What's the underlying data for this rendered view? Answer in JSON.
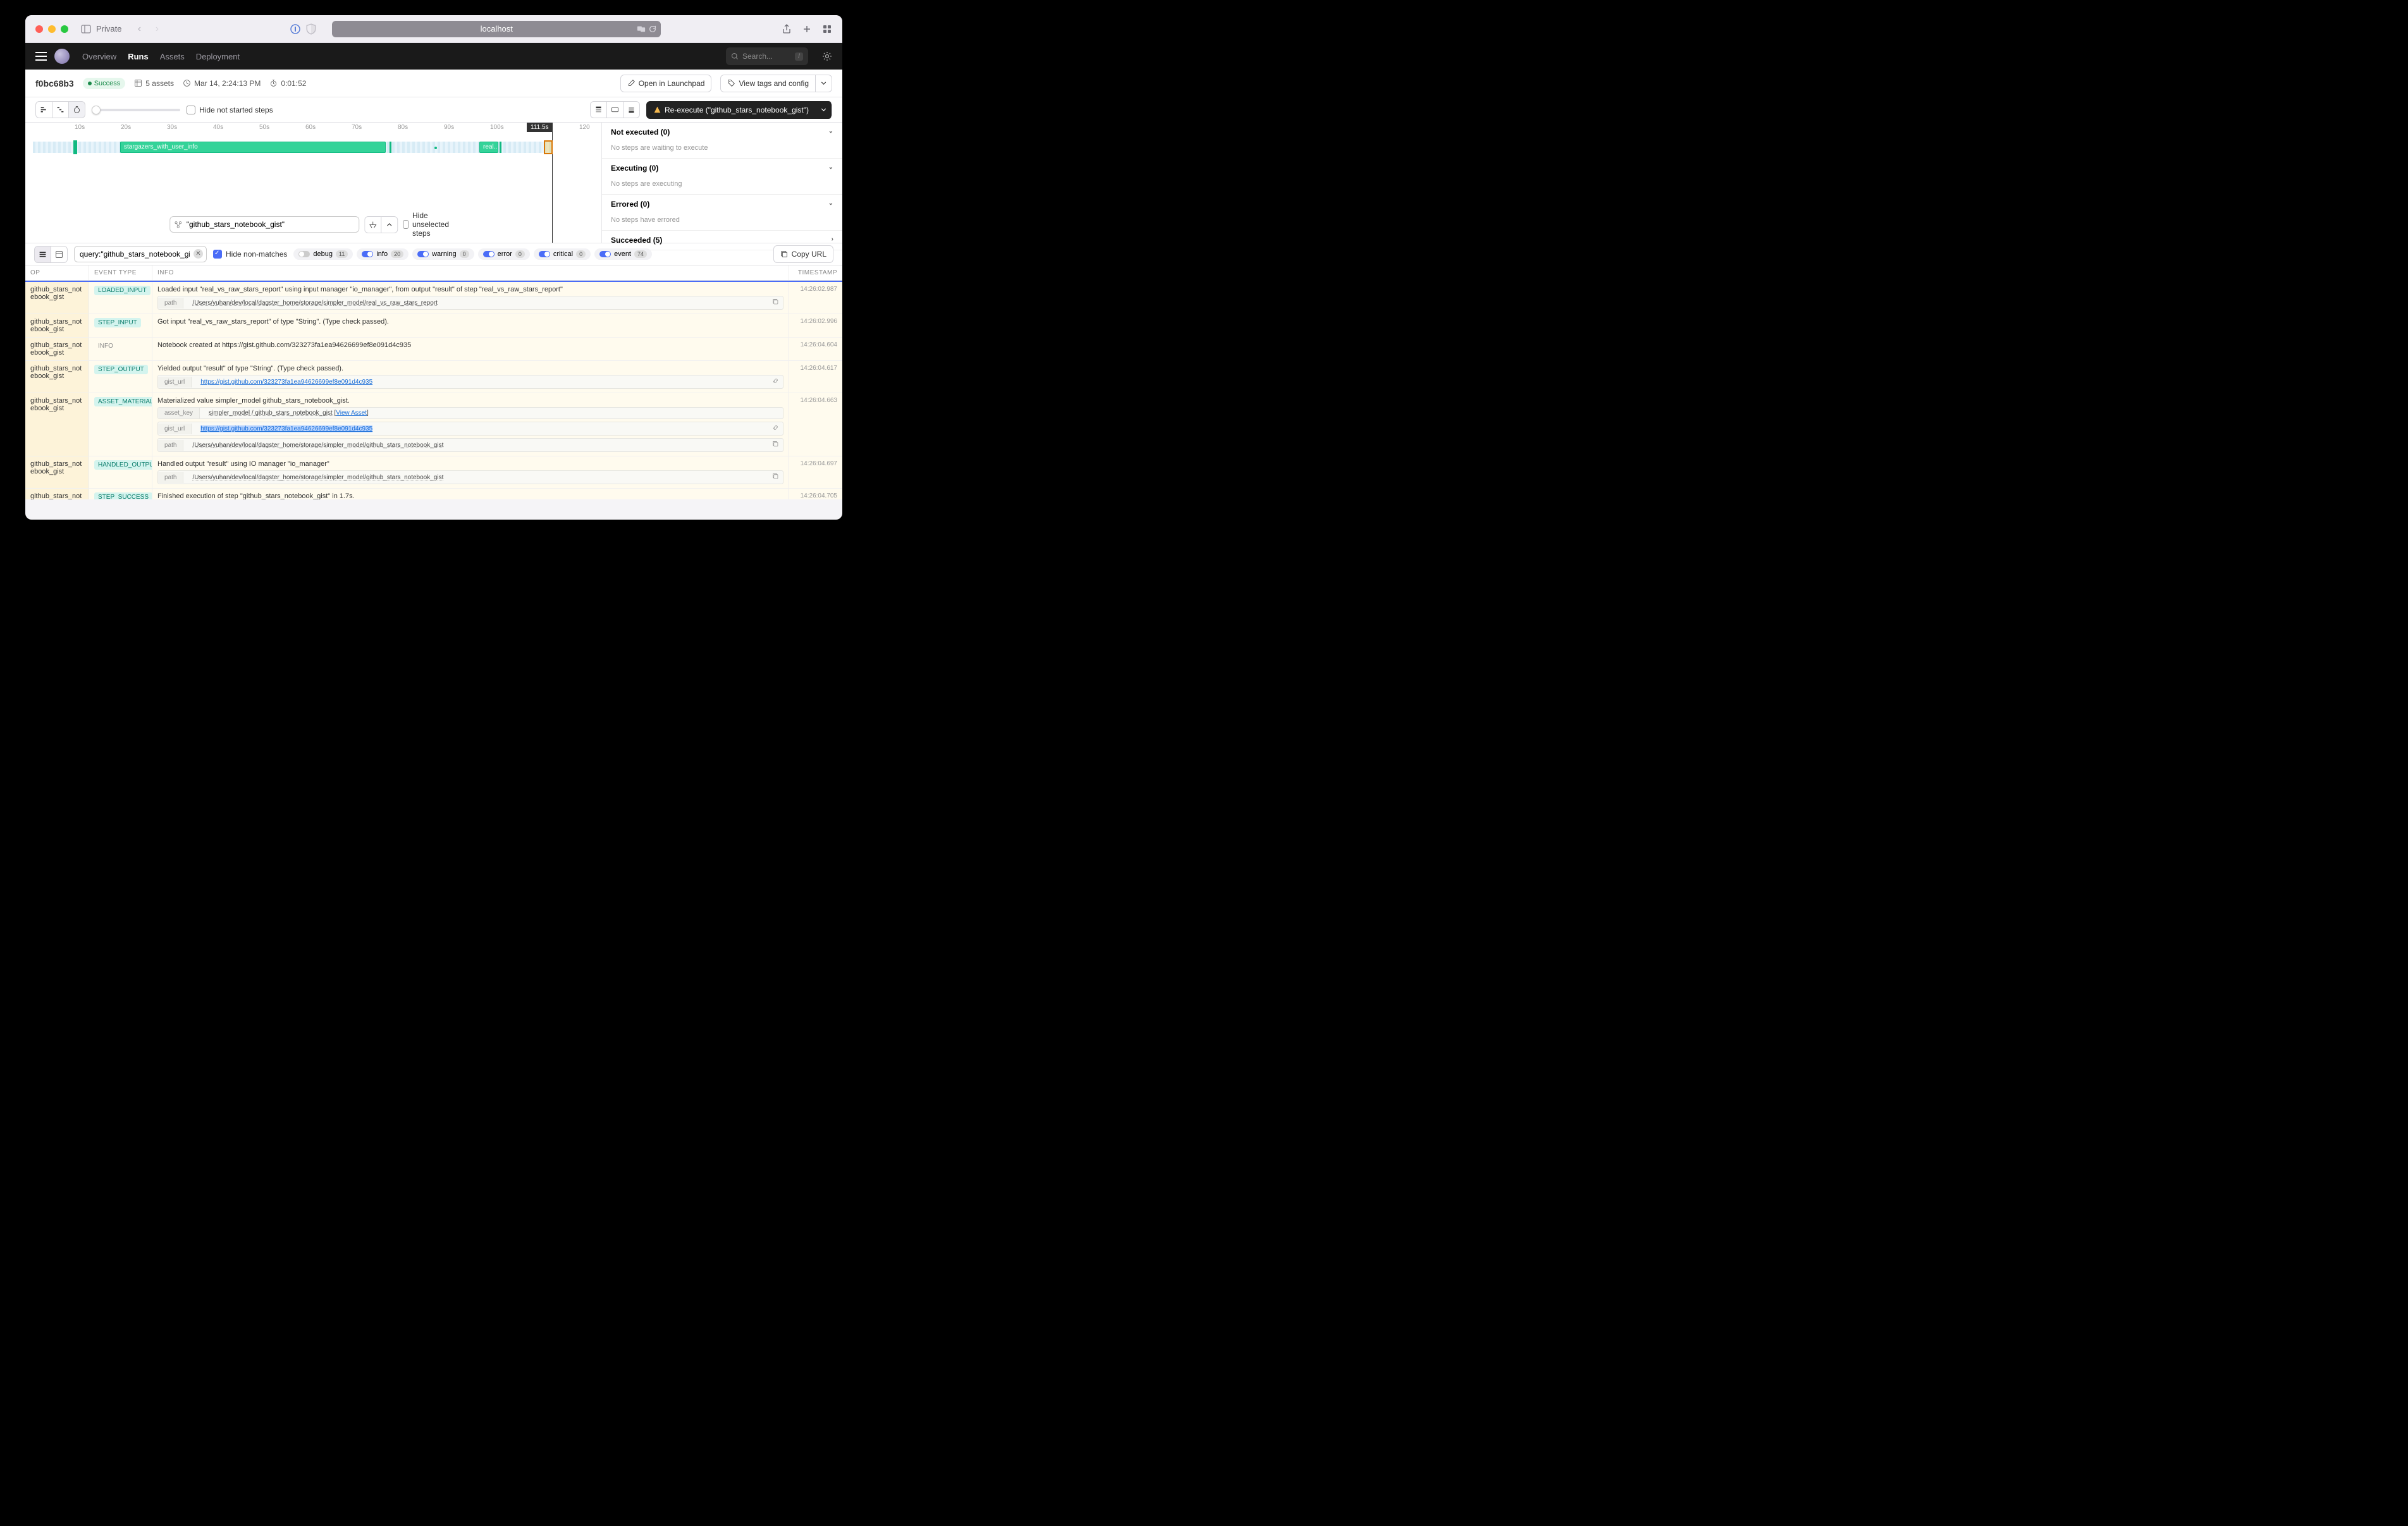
{
  "browser": {
    "private_label": "Private",
    "url": "localhost"
  },
  "nav": {
    "overview": "Overview",
    "runs": "Runs",
    "assets": "Assets",
    "deployment": "Deployment",
    "search_placeholder": "Search...",
    "search_key": "/"
  },
  "run": {
    "id": "f0bc68b3",
    "status": "Success",
    "assets": "5 assets",
    "started": "Mar 14, 2:24:13 PM",
    "duration": "0:01:52",
    "open_launchpad": "Open in Launchpad",
    "view_tags": "View tags and config"
  },
  "toolbar": {
    "hide_not_started": "Hide not started steps",
    "reexecute": "Re-execute (\"github_stars_notebook_gist\")"
  },
  "timeline": {
    "ticks": [
      "10s",
      "20s",
      "30s",
      "40s",
      "50s",
      "60s",
      "70s",
      "80s",
      "90s",
      "100s"
    ],
    "tick_end": "120",
    "current": "111.5s",
    "bar1": "stargazers_with_user_info",
    "bar2": "real..."
  },
  "gantt_filter": {
    "value": "\"github_stars_notebook_gist\"",
    "hide_unselected": "Hide unselected steps"
  },
  "side": {
    "not_executed": {
      "title": "Not executed (0)",
      "body": "No steps are waiting to execute"
    },
    "executing": {
      "title": "Executing (0)",
      "body": "No steps are executing"
    },
    "errored": {
      "title": "Errored (0)",
      "body": "No steps have errored"
    },
    "succeeded": {
      "title": "Succeeded (5)"
    }
  },
  "logs_toolbar": {
    "query": "query:\"github_stars_notebook_gist\"",
    "hide_non_matches": "Hide non-matches",
    "levels": [
      {
        "name": "debug",
        "count": "11",
        "on": false
      },
      {
        "name": "info",
        "count": "20",
        "on": true
      },
      {
        "name": "warning",
        "count": "0",
        "on": true
      },
      {
        "name": "error",
        "count": "0",
        "on": true
      },
      {
        "name": "critical",
        "count": "0",
        "on": true
      },
      {
        "name": "event",
        "count": "74",
        "on": true
      }
    ],
    "copy_url": "Copy URL"
  },
  "log_headers": {
    "op": "OP",
    "type": "EVENT TYPE",
    "info": "INFO",
    "ts": "TIMESTAMP"
  },
  "logs": [
    {
      "op": "github_stars_notebook_gist",
      "type": "LOADED_INPUT",
      "type_class": "evt",
      "info": "Loaded input \"real_vs_raw_stars_report\" using input manager \"io_manager\", from output \"result\" of step \"real_vs_raw_stars_report\"",
      "paths": [
        {
          "key": "path",
          "val": "/Users/yuhan/dev/local/dagster_home/storage/simpler_model/real_vs_raw_stars_report",
          "copy": true
        }
      ],
      "ts": "14:26:02.987"
    },
    {
      "op": "github_stars_notebook_gist",
      "type": "STEP_INPUT",
      "type_class": "evt",
      "info": "Got input \"real_vs_raw_stars_report\" of type \"String\". (Type check passed).",
      "ts": "14:26:02.996"
    },
    {
      "op": "github_stars_notebook_gist",
      "type": "INFO",
      "type_class": "info",
      "info": "Notebook created at https://gist.github.com/323273fa1ea94626699ef8e091d4c935",
      "ts": "14:26:04.604"
    },
    {
      "op": "github_stars_notebook_gist",
      "type": "STEP_OUTPUT",
      "type_class": "evt",
      "info": "Yielded output \"result\" of type \"String\". (Type check passed).",
      "paths": [
        {
          "key": "gist_url",
          "val": "https://gist.github.com/323273fa1ea94626699ef8e091d4c935",
          "link": true
        }
      ],
      "ts": "14:26:04.617"
    },
    {
      "op": "github_stars_notebook_gist",
      "type": "ASSET_MATERIALIZAT...",
      "type_class": "evt",
      "info": "Materialized value simpler_model github_stars_notebook_gist.",
      "paths": [
        {
          "key": "asset_key",
          "val": "simpler_model / github_stars_notebook_gist",
          "view_asset": true
        },
        {
          "key": "gist_url",
          "val": "https://gist.github.com/323273fa1ea94626699ef8e091d4c935",
          "link": true,
          "hl": true
        },
        {
          "key": "path",
          "val": "/Users/yuhan/dev/local/dagster_home/storage/simpler_model/github_stars_notebook_gist",
          "copy": true
        }
      ],
      "ts": "14:26:04.663"
    },
    {
      "op": "github_stars_notebook_gist",
      "type": "HANDLED_OUTPUT",
      "type_class": "evt",
      "info": "Handled output \"result\" using IO manager \"io_manager\"",
      "paths": [
        {
          "key": "path",
          "val": "/Users/yuhan/dev/local/dagster_home/storage/simpler_model/github_stars_notebook_gist",
          "copy": true
        }
      ],
      "ts": "14:26:04.697"
    },
    {
      "op": "github_stars_notebook_gist",
      "type": "STEP_SUCCESS",
      "type_class": "evt",
      "info": "Finished execution of step \"github_stars_notebook_gist\" in 1.7s.",
      "ts": "14:26:04.705"
    }
  ]
}
